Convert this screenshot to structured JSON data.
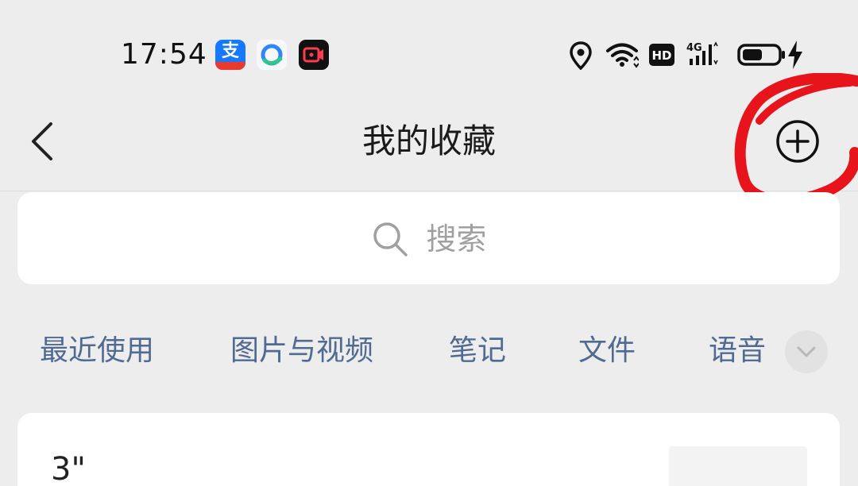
{
  "status_bar": {
    "time": "17:54",
    "app_icons": [
      "alipay-icon",
      "browser-icon",
      "video-recorder-icon"
    ],
    "alipay_glyph": "支",
    "right_icons": [
      "location-icon",
      "wifi-icon",
      "hd-icon",
      "4g-signal-icon",
      "battery-icon",
      "charging-icon"
    ],
    "hd_label": "HD",
    "network_label": "4G"
  },
  "nav": {
    "back_icon": "chevron-left-icon",
    "title": "我的收藏",
    "add_icon": "plus-circle-icon"
  },
  "search": {
    "icon": "search-icon",
    "placeholder": "搜索"
  },
  "tabs": {
    "items": [
      {
        "label": "最近使用"
      },
      {
        "label": "图片与视频"
      },
      {
        "label": "笔记"
      },
      {
        "label": "文件"
      },
      {
        "label": "语音"
      }
    ],
    "expand_icon": "chevron-down-icon"
  },
  "favorites": {
    "items": [
      {
        "text": "3\""
      }
    ]
  },
  "colors": {
    "background": "#ededed",
    "tab_text": "#516a91",
    "annotation": "#e8141c",
    "alipay_blue": "#1677ff"
  }
}
